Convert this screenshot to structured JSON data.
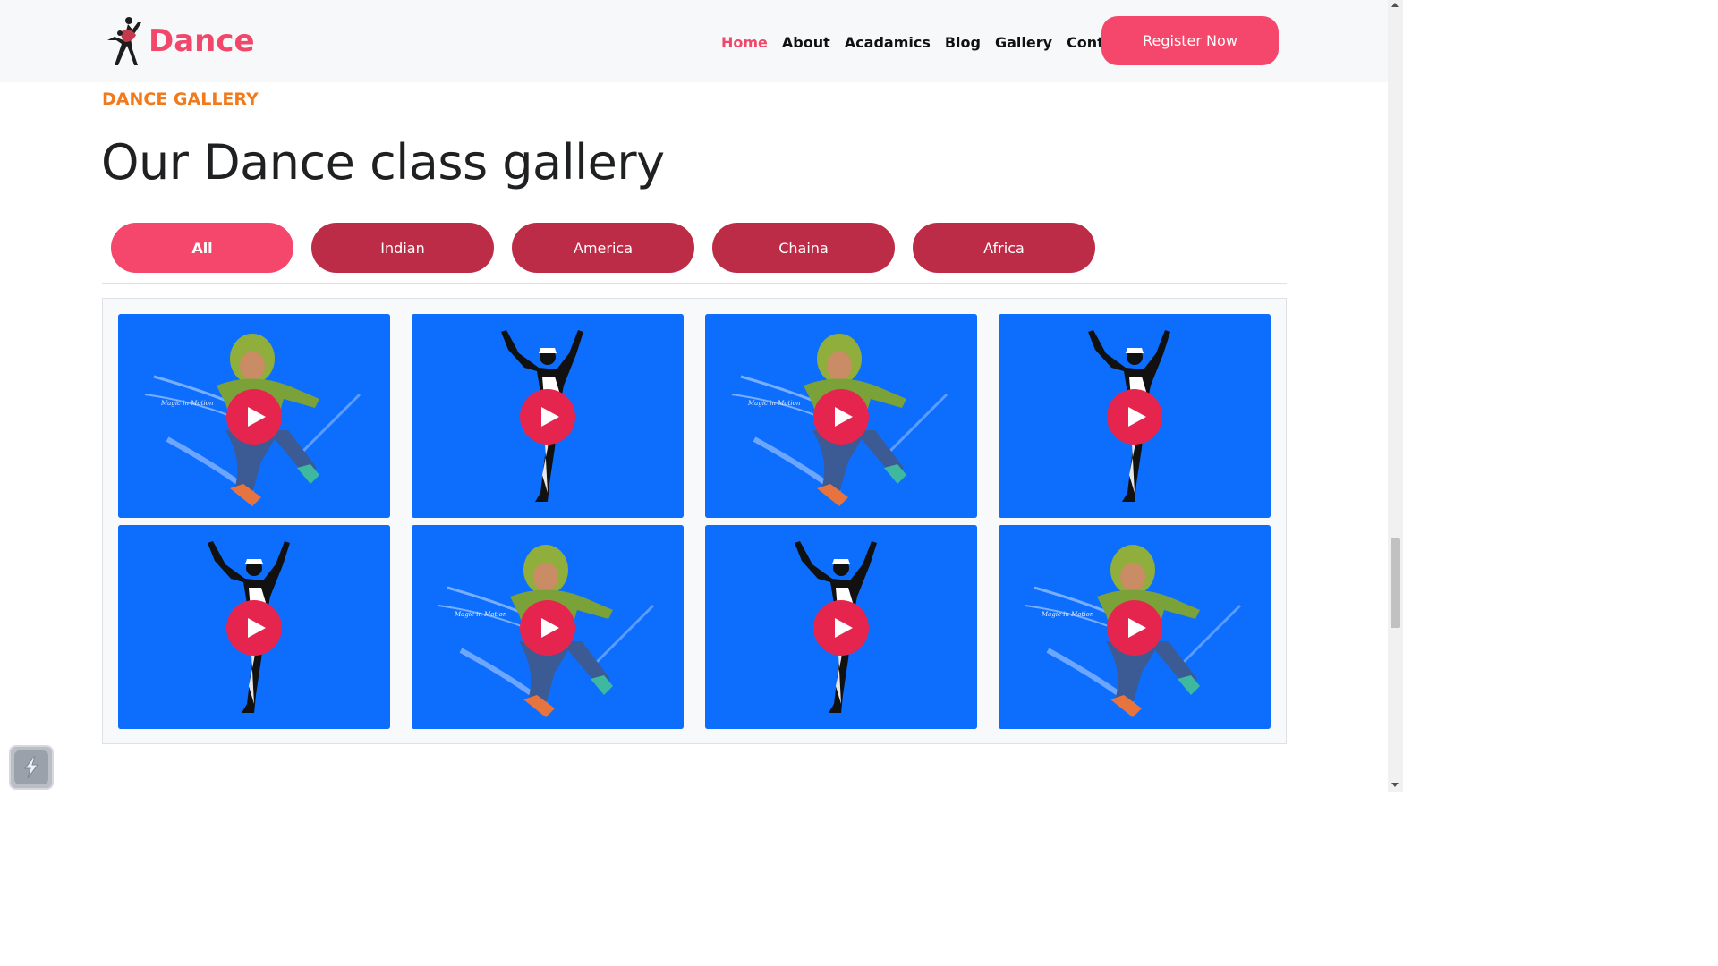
{
  "header": {
    "logo_text": "Dance",
    "nav": [
      {
        "label": "Home",
        "active": true
      },
      {
        "label": "About",
        "active": false
      },
      {
        "label": "Acadamics",
        "active": false
      },
      {
        "label": "Blog",
        "active": false
      },
      {
        "label": "Gallery",
        "active": false
      },
      {
        "label": "Contact",
        "active": false
      }
    ],
    "register_label": "Register Now"
  },
  "section": {
    "eyebrow": "DANCE GALLERY",
    "title": "Our Dance class gallery"
  },
  "filters": [
    {
      "label": "All",
      "active": true
    },
    {
      "label": "Indian",
      "active": false
    },
    {
      "label": "America",
      "active": false
    },
    {
      "label": "Chaina",
      "active": false
    },
    {
      "label": "Africa",
      "active": false
    }
  ],
  "gallery": {
    "items": [
      {
        "image": "hooded-dancer-jump",
        "icon": "play-icon"
      },
      {
        "image": "silhouette-dancer",
        "icon": "play-icon"
      },
      {
        "image": "hooded-dancer-jump",
        "icon": "play-icon"
      },
      {
        "image": "silhouette-dancer",
        "icon": "play-icon"
      },
      {
        "image": "silhouette-dancer",
        "icon": "play-icon"
      },
      {
        "image": "hooded-dancer-jump",
        "icon": "play-icon"
      },
      {
        "image": "silhouette-dancer",
        "icon": "play-icon"
      },
      {
        "image": "hooded-dancer-jump",
        "icon": "play-icon"
      }
    ]
  },
  "colors": {
    "brand": "#f4476b",
    "filter_inactive": "#bd2c47",
    "eyebrow": "#f27a1a",
    "card_bg": "#0d6efd",
    "play_button": "#e6254f"
  }
}
